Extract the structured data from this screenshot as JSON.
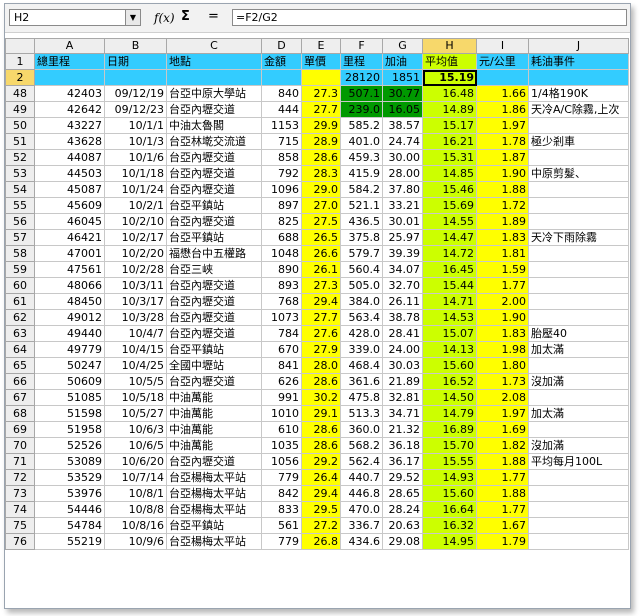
{
  "formula_bar": {
    "name_box": "H2",
    "name_dropdown": "▼",
    "fx": "f(x)",
    "sum": "Σ",
    "eq": "=",
    "formula": "=F2/G2"
  },
  "columns": [
    "A",
    "B",
    "C",
    "D",
    "E",
    "F",
    "G",
    "H",
    "I",
    "J"
  ],
  "selected_column": "H",
  "header_row": {
    "row_num": "1",
    "cells": [
      "總里程",
      "日期",
      "地點",
      "金額",
      "單價",
      "里程",
      "加油",
      "平均值",
      "元/公里",
      "耗油事件"
    ]
  },
  "summary_row": {
    "row_num": "2",
    "cells": [
      "",
      "",
      "",
      "",
      "",
      "28120",
      "1851",
      "15.19",
      "",
      ""
    ]
  },
  "rows": [
    {
      "n": "48",
      "c": [
        "42403",
        "09/12/19",
        "台亞中原大學站",
        "840",
        "27.3",
        "507.1",
        "30.77",
        "16.48",
        "1.66",
        "1/4格190K"
      ]
    },
    {
      "n": "49",
      "c": [
        "42642",
        "09/12/23",
        "台亞內壢交道",
        "444",
        "27.7",
        "239.0",
        "16.05",
        "14.89",
        "1.86",
        "天冷A/C除霧,上次"
      ]
    },
    {
      "n": "50",
      "c": [
        "43227",
        "10/1/1",
        "中油太魯閣",
        "1153",
        "29.9",
        "585.2",
        "38.57",
        "15.17",
        "1.97",
        ""
      ]
    },
    {
      "n": "51",
      "c": [
        "43628",
        "10/1/3",
        "台亞林墘交流道",
        "715",
        "28.9",
        "401.0",
        "24.74",
        "16.21",
        "1.78",
        "極少剎車"
      ]
    },
    {
      "n": "52",
      "c": [
        "44087",
        "10/1/6",
        "台亞內壢交道",
        "858",
        "28.6",
        "459.3",
        "30.00",
        "15.31",
        "1.87",
        ""
      ]
    },
    {
      "n": "53",
      "c": [
        "44503",
        "10/1/18",
        "台亞內壢交道",
        "792",
        "28.3",
        "415.9",
        "28.00",
        "14.85",
        "1.90",
        "中原剪髮、"
      ]
    },
    {
      "n": "54",
      "c": [
        "45087",
        "10/1/24",
        "台亞內壢交道",
        "1096",
        "29.0",
        "584.2",
        "37.80",
        "15.46",
        "1.88",
        ""
      ]
    },
    {
      "n": "55",
      "c": [
        "45609",
        "10/2/1",
        "台亞平鎮站",
        "897",
        "27.0",
        "521.1",
        "33.21",
        "15.69",
        "1.72",
        ""
      ]
    },
    {
      "n": "56",
      "c": [
        "46045",
        "10/2/10",
        "台亞內壢交道",
        "825",
        "27.5",
        "436.5",
        "30.01",
        "14.55",
        "1.89",
        ""
      ]
    },
    {
      "n": "57",
      "c": [
        "46421",
        "10/2/17",
        "台亞平鎮站",
        "688",
        "26.5",
        "375.8",
        "25.97",
        "14.47",
        "1.83",
        "天冷下雨除霧"
      ]
    },
    {
      "n": "58",
      "c": [
        "47001",
        "10/2/20",
        "福懋台中五權路",
        "1048",
        "26.6",
        "579.7",
        "39.39",
        "14.72",
        "1.81",
        ""
      ]
    },
    {
      "n": "59",
      "c": [
        "47561",
        "10/2/28",
        "台亞三峽",
        "890",
        "26.1",
        "560.4",
        "34.07",
        "16.45",
        "1.59",
        ""
      ]
    },
    {
      "n": "60",
      "c": [
        "48066",
        "10/3/11",
        "台亞內壢交道",
        "893",
        "27.3",
        "505.0",
        "32.70",
        "15.44",
        "1.77",
        ""
      ]
    },
    {
      "n": "61",
      "c": [
        "48450",
        "10/3/17",
        "台亞內壢交道",
        "768",
        "29.4",
        "384.0",
        "26.11",
        "14.71",
        "2.00",
        ""
      ]
    },
    {
      "n": "62",
      "c": [
        "49012",
        "10/3/28",
        "台亞內壢交道",
        "1073",
        "27.7",
        "563.4",
        "38.78",
        "14.53",
        "1.90",
        ""
      ]
    },
    {
      "n": "63",
      "c": [
        "49440",
        "10/4/7",
        "台亞內壢交道",
        "784",
        "27.6",
        "428.0",
        "28.41",
        "15.07",
        "1.83",
        "胎壓40"
      ]
    },
    {
      "n": "64",
      "c": [
        "49779",
        "10/4/15",
        "台亞平鎮站",
        "670",
        "27.9",
        "339.0",
        "24.00",
        "14.13",
        "1.98",
        "加太滿"
      ]
    },
    {
      "n": "65",
      "c": [
        "50247",
        "10/4/25",
        "全國中壢站",
        "841",
        "28.0",
        "468.4",
        "30.03",
        "15.60",
        "1.80",
        ""
      ]
    },
    {
      "n": "66",
      "c": [
        "50609",
        "10/5/5",
        "台亞內壢交道",
        "626",
        "28.6",
        "361.6",
        "21.89",
        "16.52",
        "1.73",
        "沒加滿"
      ]
    },
    {
      "n": "67",
      "c": [
        "51085",
        "10/5/18",
        "中油萬能",
        "991",
        "30.2",
        "475.8",
        "32.81",
        "14.50",
        "2.08",
        ""
      ]
    },
    {
      "n": "68",
      "c": [
        "51598",
        "10/5/27",
        "中油萬能",
        "1010",
        "29.1",
        "513.3",
        "34.71",
        "14.79",
        "1.97",
        "加太滿"
      ]
    },
    {
      "n": "69",
      "c": [
        "51958",
        "10/6/3",
        "中油萬能",
        "610",
        "28.6",
        "360.0",
        "21.32",
        "16.89",
        "1.69",
        ""
      ]
    },
    {
      "n": "70",
      "c": [
        "52526",
        "10/6/5",
        "中油萬能",
        "1035",
        "28.6",
        "568.2",
        "36.18",
        "15.70",
        "1.82",
        "沒加滿"
      ]
    },
    {
      "n": "71",
      "c": [
        "53089",
        "10/6/20",
        "台亞內壢交道",
        "1056",
        "29.2",
        "562.4",
        "36.17",
        "15.55",
        "1.88",
        "平均每月100L"
      ]
    },
    {
      "n": "72",
      "c": [
        "53529",
        "10/7/14",
        "台亞楊梅太平站",
        "779",
        "26.4",
        "440.7",
        "29.52",
        "14.93",
        "1.77",
        ""
      ]
    },
    {
      "n": "73",
      "c": [
        "53976",
        "10/8/1",
        "台亞楊梅太平站",
        "842",
        "29.4",
        "446.8",
        "28.65",
        "15.60",
        "1.88",
        ""
      ]
    },
    {
      "n": "74",
      "c": [
        "54446",
        "10/8/8",
        "台亞楊梅太平站",
        "833",
        "29.5",
        "470.0",
        "28.24",
        "16.64",
        "1.77",
        ""
      ]
    },
    {
      "n": "75",
      "c": [
        "54784",
        "10/8/16",
        "台亞平鎮站",
        "561",
        "27.2",
        "336.7",
        "20.63",
        "16.32",
        "1.67",
        ""
      ]
    },
    {
      "n": "76",
      "c": [
        "55219",
        "10/9/6",
        "台亞楊梅太平站",
        "779",
        "26.8",
        "434.6",
        "29.08",
        "14.95",
        "1.79",
        ""
      ]
    }
  ],
  "highlight": {
    "dark_green_rows": [
      "48",
      "49"
    ],
    "dark_green_cols": [
      5,
      6
    ]
  },
  "colors": {
    "header_cyan": "#33ccff",
    "column_yellow": "#ffff00",
    "column_yellowgreen": "#ccff00",
    "dark_green": "#009900",
    "selection_orange": "#f7d86b"
  }
}
